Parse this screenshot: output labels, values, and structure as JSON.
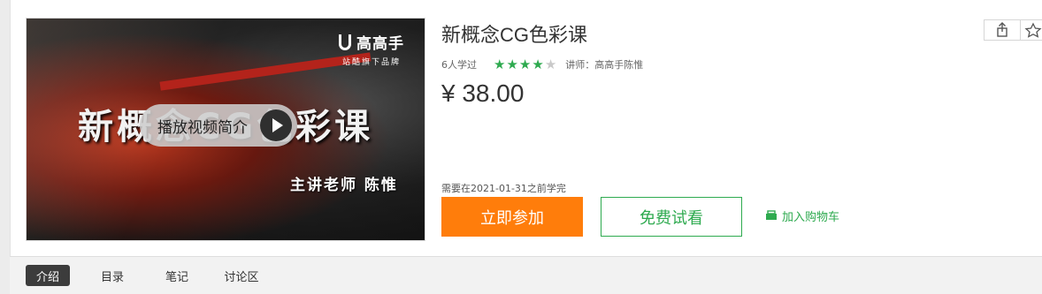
{
  "course": {
    "title": "新概念CG色彩课",
    "learners": "6人学过",
    "rating": 4,
    "rating_max": 5,
    "instructor": "讲师：高高手陈惟",
    "price": "¥ 38.00",
    "deadline": "需要在2021-01-31之前学完"
  },
  "cover": {
    "brand_name": "高高手",
    "brand_sub": "站酷旗下品牌",
    "title": "新概念CG色彩课",
    "teacher": "主讲老师 陈惟",
    "play_label": "播放视频简介"
  },
  "actions": {
    "join_label": "立即参加",
    "trial_label": "免费试看",
    "cart_label": "加入购物车"
  },
  "tabs": [
    {
      "label": "介绍",
      "active": true
    },
    {
      "label": "目录",
      "active": false
    },
    {
      "label": "笔记",
      "active": false
    },
    {
      "label": "讨论区",
      "active": false
    }
  ],
  "colors": {
    "accent_orange": "#ff7d0b",
    "accent_green": "#2eaa4f",
    "active_tab": "#3c3c3c"
  },
  "icons": {
    "share": "share-icon",
    "favorite": "star-icon",
    "cart": "cart-icon",
    "play": "play-icon"
  }
}
